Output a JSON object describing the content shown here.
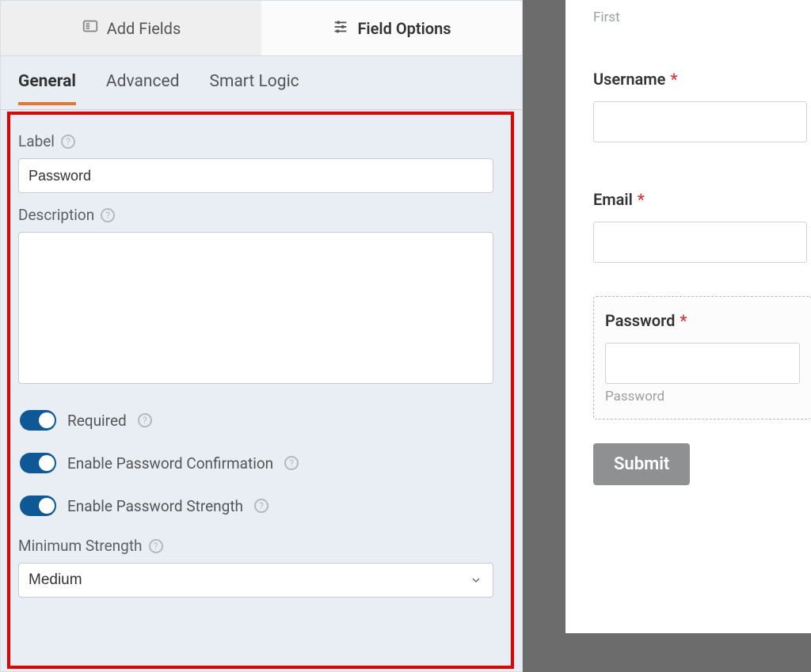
{
  "top_tabs": {
    "add_fields": "Add Fields",
    "field_options": "Field Options"
  },
  "sub_tabs": {
    "general": "General",
    "advanced": "Advanced",
    "smart_logic": "Smart Logic"
  },
  "options": {
    "label_label": "Label",
    "label_value": "Password",
    "description_label": "Description",
    "description_value": "",
    "required_label": "Required",
    "confirmation_label": "Enable Password Confirmation",
    "strength_label": "Enable Password Strength",
    "min_strength_label": "Minimum Strength",
    "min_strength_value": "Medium",
    "toggles": {
      "required": true,
      "confirmation": true,
      "strength": true
    }
  },
  "preview": {
    "first_sublabel": "First",
    "username_label": "Username",
    "email_label": "Email",
    "password_label": "Password",
    "password_sublabel": "Password",
    "submit": "Submit"
  }
}
